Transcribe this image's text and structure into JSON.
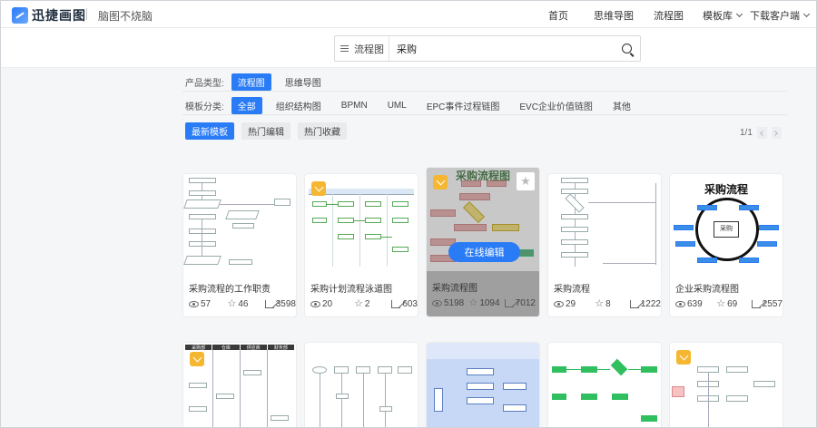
{
  "header": {
    "brand": "迅捷画图",
    "slogan": "脑图不烧脑",
    "nav": [
      "首页",
      "思维导图",
      "流程图"
    ],
    "template_menu": "模板库",
    "download_menu": "下载客户端"
  },
  "search": {
    "type_label": "流程图",
    "query": "采购"
  },
  "filters": {
    "product_label": "产品类型:",
    "product_types": [
      "流程图",
      "思维导图"
    ],
    "category_label": "模板分类:",
    "categories": [
      "全部",
      "组织结构图",
      "BPMN",
      "UML",
      "EPC事件过程链图",
      "EVC企业价值链图",
      "其他"
    ],
    "sorts": [
      "最新模板",
      "热门编辑",
      "热门收藏"
    ],
    "page": "1/1"
  },
  "overlay": {
    "edit_label": "在线编辑"
  },
  "cards": [
    {
      "title": "采购流程的工作职责",
      "views": "57",
      "stars": "46",
      "edits": "3598"
    },
    {
      "title": "采购计划流程泳道图",
      "views": "20",
      "stars": "2",
      "edits": "603"
    },
    {
      "title": "采购流程图",
      "views": "5198",
      "stars": "1094",
      "edits": "7012",
      "thumb_title": "采购流程图"
    },
    {
      "title": "采购流程",
      "views": "29",
      "stars": "8",
      "edits": "1222"
    },
    {
      "title": "企业采购流程图",
      "views": "639",
      "stars": "69",
      "edits": "2557",
      "thumb_title": "采购流程",
      "thumb_center": "采购"
    }
  ],
  "row2_headers": [
    "采购部",
    "仓库",
    "供应商",
    "财务部"
  ],
  "colors": {
    "accent": "#2a7bf6",
    "vip": "#f5b731"
  }
}
